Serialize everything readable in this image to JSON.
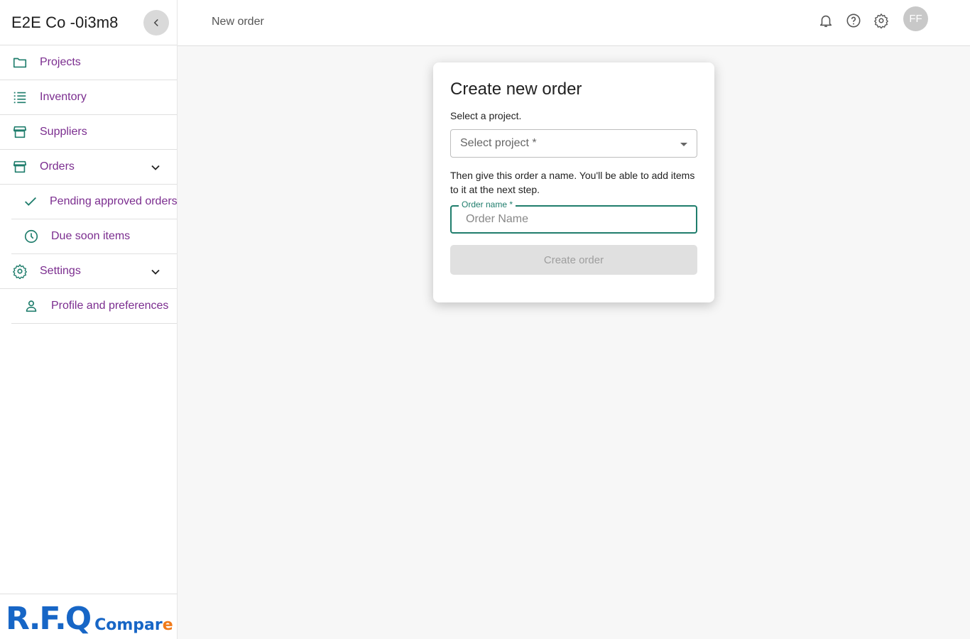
{
  "sidebar": {
    "company_name": "E2E Co -0i3m8",
    "items": [
      {
        "label": "Projects",
        "icon": "folder-icon"
      },
      {
        "label": "Inventory",
        "icon": "list-icon"
      },
      {
        "label": "Suppliers",
        "icon": "storefront-icon"
      },
      {
        "label": "Orders",
        "icon": "storefront-icon",
        "expanded": true
      },
      {
        "label": "Pending approved orders",
        "icon": "check-icon"
      },
      {
        "label": "Due soon items",
        "icon": "clock-icon"
      },
      {
        "label": "Settings",
        "icon": "gear-icon",
        "expanded": true
      },
      {
        "label": "Profile and preferences",
        "icon": "person-icon"
      }
    ],
    "logo": {
      "big": "R.F.Q",
      "small_main": "Compar",
      "small_accent": "e"
    }
  },
  "header": {
    "title": "New order",
    "avatar_initials": "FF"
  },
  "dialog": {
    "title": "Create new order",
    "select_prompt": "Select a project.",
    "select_placeholder": "Select project *",
    "name_prompt": "Then give this order a name. You'll be able to add items to it at the next step.",
    "name_label": "Order name *",
    "name_placeholder": "Order Name",
    "name_value": "",
    "submit_label": "Create order",
    "submit_enabled": false
  },
  "colors": {
    "accent": "#1f7d6c",
    "nav_text": "#7b2d8f",
    "logo_blue": "#1766c6",
    "logo_orange": "#f07a1a"
  }
}
